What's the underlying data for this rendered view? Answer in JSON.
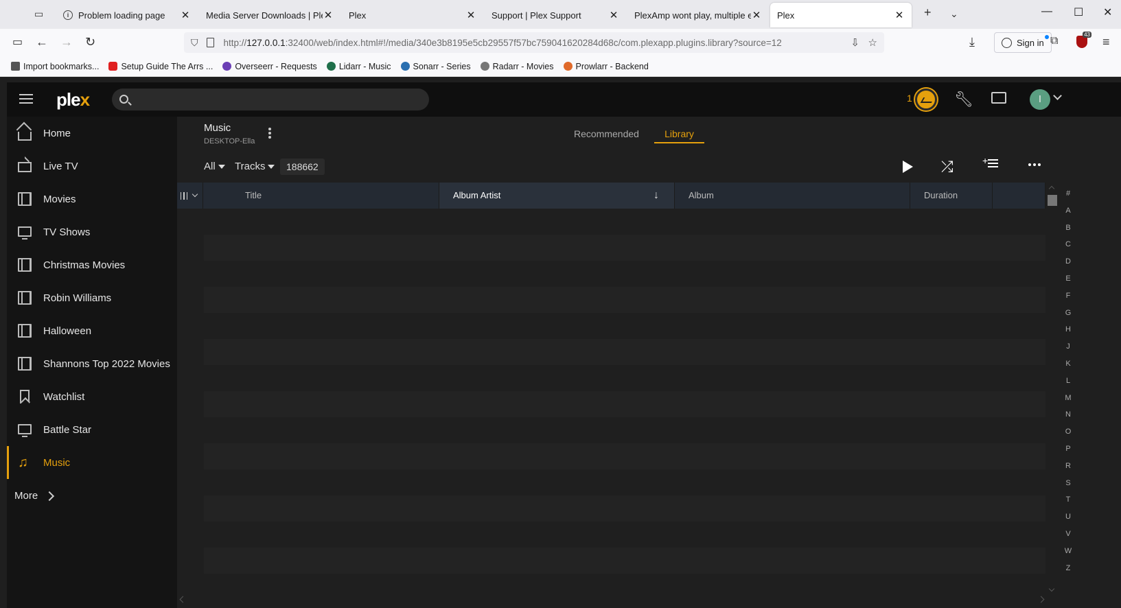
{
  "browser": {
    "tabs": [
      {
        "title": "Problem loading page",
        "icon": "info-icon",
        "active": false
      },
      {
        "title": "Media Server Downloads | Ple",
        "icon": "plex-favicon",
        "active": false
      },
      {
        "title": "Plex",
        "icon": "plex-favicon",
        "active": false
      },
      {
        "title": "Support | Plex Support",
        "icon": "plex-favicon",
        "active": false
      },
      {
        "title": "PlexAmp wont play, multiple e",
        "icon": "plex-favicon",
        "active": false
      },
      {
        "title": "Plex",
        "icon": "plex-favicon",
        "active": true
      }
    ],
    "url_host": "127.0.0.1",
    "url_prefix": "http://",
    "url_rest": ":32400/web/index.html#!/media/340e3b8195e5cb29557f57bc759041620284d68c/com.plexapp.plugins.library?source=12",
    "sign_in_label": "Sign in",
    "extension_badge": "43",
    "bookmarks": [
      {
        "label": "Import bookmarks...",
        "color": "#555555"
      },
      {
        "label": "Setup Guide The Arrs ...",
        "color": "#e02020"
      },
      {
        "label": "Overseerr - Requests",
        "color": "#6b3fb5"
      },
      {
        "label": "Lidarr - Music",
        "color": "#1f6f4a"
      },
      {
        "label": "Sonarr - Series",
        "color": "#2a6fb0"
      },
      {
        "label": "Radarr - Movies",
        "color": "#777777"
      },
      {
        "label": "Prowlarr - Backend",
        "color": "#e06a2a"
      }
    ]
  },
  "plex": {
    "logo_main": "ple",
    "logo_x": "x",
    "activity_count": "1",
    "avatar_initial": "I",
    "sidebar": [
      {
        "label": "Home",
        "icon": "home-icon"
      },
      {
        "label": "Live TV",
        "icon": "live-tv-icon"
      },
      {
        "label": "Movies",
        "icon": "film-icon"
      },
      {
        "label": "TV Shows",
        "icon": "tv-icon"
      },
      {
        "label": "Christmas Movies",
        "icon": "film-icon"
      },
      {
        "label": "Robin Williams",
        "icon": "film-icon"
      },
      {
        "label": "Halloween",
        "icon": "film-icon"
      },
      {
        "label": "Shannons Top 2022 Movies",
        "icon": "film-icon"
      },
      {
        "label": "Watchlist",
        "icon": "bookmark-icon"
      },
      {
        "label": "Battle Star",
        "icon": "tv-icon"
      },
      {
        "label": "Music",
        "icon": "music-icon",
        "active": true
      }
    ],
    "more_label": "More",
    "library": {
      "title": "Music",
      "server": "DESKTOP-Ella",
      "tab_recommended": "Recommended",
      "tab_library": "Library",
      "filter_all": "All",
      "filter_type": "Tracks",
      "item_count": "188662",
      "columns": [
        "Title",
        "Album Artist",
        "Album",
        "Duration"
      ],
      "sorted_column": "Album Artist",
      "sort_direction": "descending",
      "jump_letters": [
        "#",
        "A",
        "B",
        "C",
        "D",
        "E",
        "F",
        "G",
        "H",
        "J",
        "K",
        "L",
        "M",
        "N",
        "O",
        "P",
        "R",
        "S",
        "T",
        "U",
        "V",
        "W",
        "Z"
      ]
    },
    "accent_color": "#e5a00d"
  }
}
